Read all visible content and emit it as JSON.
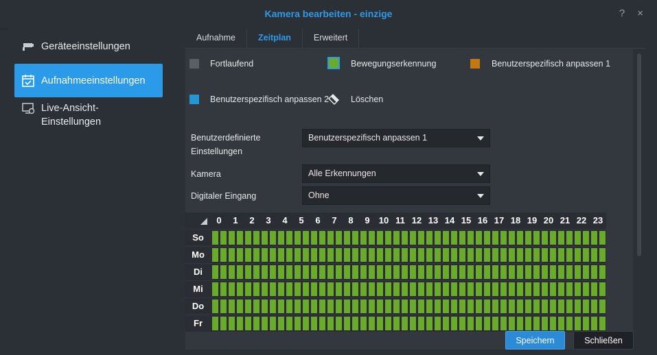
{
  "window": {
    "title": "Kamera bearbeiten - einzige",
    "help_icon": "?",
    "close_icon": "×"
  },
  "sidebar": {
    "items": [
      {
        "label": "Geräteeinstellungen",
        "icon": "camera-icon",
        "active": false
      },
      {
        "label": "Aufnahmeeinstellungen",
        "icon": "calendar-check-icon",
        "active": true
      },
      {
        "label": "Live-Ansicht-Einstellungen",
        "icon": "monitor-icon",
        "active": false
      }
    ]
  },
  "tabs": [
    {
      "label": "Aufnahme",
      "active": false
    },
    {
      "label": "Zeitplan",
      "active": true
    },
    {
      "label": "Erweitert",
      "active": false
    }
  ],
  "legend": {
    "continuous": "Fortlaufend",
    "motion": "Bewegungserkennung",
    "custom1": "Benutzerspezifisch anpassen 1",
    "custom2": "Benutzerspezifisch anpassen 2",
    "delete": "Löschen"
  },
  "colors": {
    "continuous": "#5a5f66",
    "motion": "#6aab2c",
    "custom1": "#c07a12",
    "custom2": "#2596d1",
    "accent": "#2f9be8"
  },
  "form": {
    "custom_settings_label": "Benutzerdefinierte Einstellungen",
    "custom_settings_value": "Benutzerspezifisch anpassen 1",
    "camera_label": "Kamera",
    "camera_value": "Alle Erkennungen",
    "digital_input_label": "Digitaler Eingang",
    "digital_input_value": "Ohne"
  },
  "schedule": {
    "hours": [
      "0",
      "1",
      "2",
      "3",
      "4",
      "5",
      "6",
      "7",
      "8",
      "9",
      "10",
      "11",
      "12",
      "13",
      "14",
      "15",
      "16",
      "17",
      "18",
      "19",
      "20",
      "21",
      "22",
      "23"
    ],
    "days": [
      "So",
      "Mo",
      "Di",
      "Mi",
      "Do",
      "Fr"
    ],
    "fill": "motion"
  },
  "footer": {
    "save": "Speichern",
    "close": "Schließen"
  }
}
